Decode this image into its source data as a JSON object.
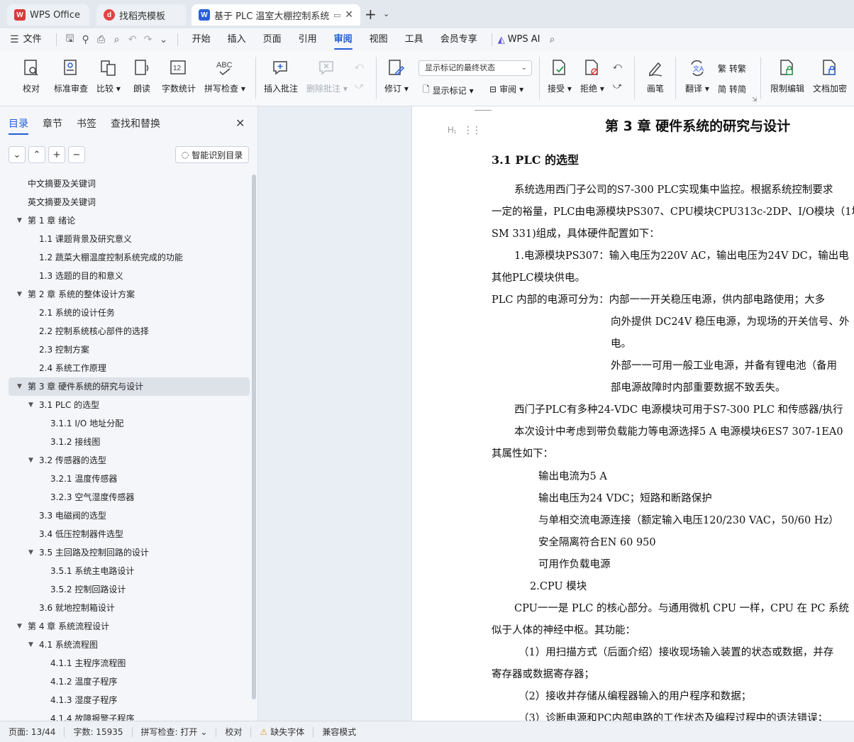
{
  "tabs": [
    {
      "label": "WPS Office",
      "color": "#d93a3a"
    },
    {
      "label": "找稻壳模板",
      "color": "#e04444"
    },
    {
      "label": "基于 PLC 温室大棚控制系统设",
      "color": "#2b5fd9"
    }
  ],
  "menu": {
    "file": "文件",
    "items": [
      "开始",
      "插入",
      "页面",
      "引用",
      "审阅",
      "视图",
      "工具",
      "会员专享"
    ],
    "ai": "WPS AI"
  },
  "ribbon": {
    "proofread": "校对",
    "std_review": "标准审查",
    "compare": "比较",
    "read_aloud": "朗读",
    "word_count": "字数统计",
    "spell_check": "拼写检查",
    "insert_comment": "插入批注",
    "delete_comment": "删除批注",
    "track": "修订",
    "display_state": "显示标记的最终状态",
    "show_markup": "显示标记",
    "review": "审阅",
    "accept": "接受",
    "reject": "拒绝",
    "pen": "画笔",
    "translate": "翻译",
    "to_trad": "转繁",
    "to_simp": "转简",
    "restrict": "限制编辑",
    "encrypt": "文档加密"
  },
  "sidebar": {
    "tabs": [
      "目录",
      "章节",
      "书签",
      "查找和替换"
    ],
    "smart_btn": "智能识别目录",
    "toc": [
      {
        "t": "中文摘要及关键词",
        "lv": 0
      },
      {
        "t": "英文摘要及关键词",
        "lv": 0
      },
      {
        "t": "第 1 章  绪论",
        "lv": 0,
        "exp": true
      },
      {
        "t": "1.1  课题背景及研究意义",
        "lv": 1
      },
      {
        "t": "1.2  蔬菜大棚温度控制系统完成的功能",
        "lv": 1
      },
      {
        "t": "1.3  选题的目的和意义",
        "lv": 1
      },
      {
        "t": "第 2 章  系统的整体设计方案",
        "lv": 0,
        "exp": true
      },
      {
        "t": "2.1 系统的设计任务",
        "lv": 1
      },
      {
        "t": "2.2  控制系统核心部件的选择",
        "lv": 1
      },
      {
        "t": "2.3 控制方案",
        "lv": 1
      },
      {
        "t": "2.4 系统工作原理",
        "lv": 1
      },
      {
        "t": "第 3 章  硬件系统的研究与设计",
        "lv": 0,
        "exp": true,
        "sel": true
      },
      {
        "t": "3.1 PLC 的选型",
        "lv": 1,
        "exp": true
      },
      {
        "t": "3.1.1 I/O 地址分配",
        "lv": 2
      },
      {
        "t": "3.1.2  接线图",
        "lv": 2
      },
      {
        "t": "3.2  传感器的选型",
        "lv": 1,
        "exp": true
      },
      {
        "t": "3.2.1 温度传感器",
        "lv": 2
      },
      {
        "t": "3.2.3  空气湿度传感器",
        "lv": 2
      },
      {
        "t": "3.3  电磁阀的选型",
        "lv": 1
      },
      {
        "t": "3.4 低压控制器件选型",
        "lv": 1
      },
      {
        "t": "3.5 主回路及控制回路的设计",
        "lv": 1,
        "exp": true
      },
      {
        "t": "3.5.1  系统主电路设计",
        "lv": 2
      },
      {
        "t": "3.5.2  控制回路设计",
        "lv": 2
      },
      {
        "t": "3.6  就地控制箱设计",
        "lv": 1
      },
      {
        "t": "第 4 章  系统流程设计",
        "lv": 0,
        "exp": true
      },
      {
        "t": "4.1 系统流程图",
        "lv": 1,
        "exp": true
      },
      {
        "t": "4.1.1  主程序流程图",
        "lv": 2
      },
      {
        "t": "4.1.2  温度子程序",
        "lv": 2
      },
      {
        "t": "4.1.3  湿度子程序",
        "lv": 2
      },
      {
        "t": "4.1.4  故障报警子程序",
        "lv": 2
      }
    ]
  },
  "doc": {
    "h1": "第 3 章  硬件系统的研究与设计",
    "h2": "3.1 PLC 的选型",
    "hmark": "H₁",
    "lines": [
      "系统选用西门子公司的S7-300 PLC实现集中监控。根据系统控制要求",
      "一定的裕量，PLC由电源模块PS307、CPU模块CPU313c-2DP、I/O模块（1块",
      "SM 331)组成，具体硬件配置如下：",
      "1.电源模块PS307：输入电压为220V AC，输出电压为24V DC，输出电",
      "其他PLC模块供电。",
      "PLC 内部的电源可分为：内部一一开关稳压电源，供内部电路使用；大多",
      "向外提供 DC24V 稳压电源，为现场的开关信号、外",
      "电。",
      "外部一一可用一般工业电源，并备有锂电池（备用",
      "部电源故障时内部重要数据不致丢失。",
      "西门子PLC有多种24-VDC 电源模块可用于S7-300 PLC 和传感器/执行",
      "本次设计中考虑到带负载能力等电源选择5 A 电源模块6ES7 307-1EA0",
      "其属性如下：",
      "输出电流为5 A",
      "输出电压为24 VDC；短路和断路保护",
      "与单相交流电源连接（额定输入电压120/230 VAC，50/60 Hz）",
      "安全隔离符合EN 60 950",
      "可用作负载电源",
      "2.CPU 模块",
      "CPU一一是 PLC 的核心部分。与通用微机 CPU 一样，CPU 在 PC 系统",
      "似于人体的神经中枢。其功能：",
      "（1）用扫描方式（后面介绍）接收现场输入装置的状态或数据，并存",
      "寄存器或数据寄存器；",
      "（2）接收并存储从编程器输入的用户程序和数据；",
      "（3）诊断电源和PC内部电路的工作状态及编程过程中的语法错误；"
    ]
  },
  "status": {
    "page": "页面: 13/44",
    "words": "字数: 15935",
    "spell": "拼写检查: 打开",
    "proof": "校对",
    "missing_font": "缺失字体",
    "compat": "兼容模式"
  }
}
